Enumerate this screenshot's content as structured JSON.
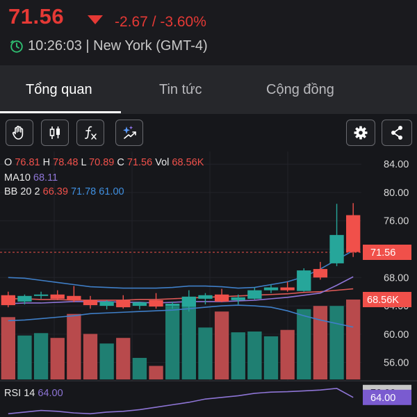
{
  "quote": {
    "price": "71.56",
    "change": "-2.67 / -3.60%",
    "time_zone": "10:26:03 | New York (GMT-4)",
    "colors": {
      "down": "#e53935",
      "up": "#26a69a",
      "clock": "#2fbf71"
    }
  },
  "tabs": [
    {
      "label": "Tổng quan",
      "active": true
    },
    {
      "label": "Tin tức",
      "active": false
    },
    {
      "label": "Cộng đồng",
      "active": false
    }
  ],
  "toolbar": {
    "left_icons": [
      "hand-icon",
      "candlestick-icon",
      "function-icon",
      "ai-sparkle-icon"
    ],
    "right_icons": [
      "gear-icon",
      "share-icon"
    ]
  },
  "legend": {
    "o_label": "O",
    "o_value": "76.81",
    "h_label": "H",
    "h_value": "78.48",
    "l_label": "L",
    "l_value": "70.89",
    "c_label": "C",
    "c_value": "71.56",
    "vol_label": "Vol",
    "vol_value": "68.56K",
    "ma_label": "MA10",
    "ma_value": "68.11",
    "bb_label": "BB 20 2",
    "bb_mid": "66.39",
    "bb_up": "71.78",
    "bb_low": "61.00",
    "rsi_label": "RSI 14",
    "rsi_value": "64.00"
  },
  "chart_data": {
    "type": "candlestick",
    "y_ticks": [
      "84.00",
      "80.00",
      "76.00",
      "72.00",
      "68.00",
      "64.00",
      "60.00",
      "56.00"
    ],
    "ylim": [
      54,
      85
    ],
    "current_price_tag": "71.56",
    "current_volume_tag": "68.56K",
    "rsi_ticks": [
      "70.00"
    ],
    "rsi_current_tag": "64.00",
    "candles": [
      {
        "o": 65.5,
        "h": 66.0,
        "l": 63.8,
        "c": 64.1,
        "vol": 0.78
      },
      {
        "o": 64.6,
        "h": 65.6,
        "l": 64.2,
        "c": 65.4,
        "vol": 0.55
      },
      {
        "o": 65.4,
        "h": 66.0,
        "l": 65.0,
        "c": 65.6,
        "vol": 0.58
      },
      {
        "o": 65.6,
        "h": 66.2,
        "l": 64.8,
        "c": 65.0,
        "vol": 0.52
      },
      {
        "o": 65.4,
        "h": 66.8,
        "l": 64.5,
        "c": 64.8,
        "vol": 0.82
      },
      {
        "o": 64.8,
        "h": 65.4,
        "l": 63.6,
        "c": 64.1,
        "vol": 0.57
      },
      {
        "o": 64.0,
        "h": 64.8,
        "l": 63.5,
        "c": 64.6,
        "vol": 0.45
      },
      {
        "o": 64.8,
        "h": 65.5,
        "l": 63.6,
        "c": 63.8,
        "vol": 0.52
      },
      {
        "o": 64.0,
        "h": 64.6,
        "l": 63.5,
        "c": 64.5,
        "vol": 0.27
      },
      {
        "o": 64.8,
        "h": 65.8,
        "l": 63.6,
        "c": 63.9,
        "vol": 0.17
      },
      {
        "o": 64.0,
        "h": 64.6,
        "l": 63.6,
        "c": 64.3,
        "vol": 0.92
      },
      {
        "o": 63.9,
        "h": 66.2,
        "l": 63.2,
        "c": 65.3,
        "vol": 0.94
      },
      {
        "o": 65.0,
        "h": 65.8,
        "l": 64.2,
        "c": 65.5,
        "vol": 0.65
      },
      {
        "o": 65.6,
        "h": 66.4,
        "l": 64.5,
        "c": 64.6,
        "vol": 0.85
      },
      {
        "o": 64.8,
        "h": 65.6,
        "l": 64.2,
        "c": 65.2,
        "vol": 0.59
      },
      {
        "o": 65.0,
        "h": 66.6,
        "l": 64.9,
        "c": 66.2,
        "vol": 0.6
      },
      {
        "o": 66.2,
        "h": 67.0,
        "l": 65.8,
        "c": 66.6,
        "vol": 0.54
      },
      {
        "o": 66.6,
        "h": 67.4,
        "l": 66.0,
        "c": 66.2,
        "vol": 0.62
      },
      {
        "o": 66.1,
        "h": 69.3,
        "l": 66.0,
        "c": 69.0,
        "vol": 0.88
      },
      {
        "o": 69.2,
        "h": 70.2,
        "l": 67.7,
        "c": 68.0,
        "vol": 0.92
      },
      {
        "o": 70.0,
        "h": 78.4,
        "l": 69.6,
        "c": 74.0,
        "vol": 0.92
      },
      {
        "o": 76.8,
        "h": 78.5,
        "l": 70.9,
        "c": 71.6,
        "vol": 1.0
      }
    ],
    "ma10": [
      64.3,
      64.4,
      64.4,
      64.5,
      64.6,
      64.6,
      64.6,
      64.5,
      64.5,
      64.4,
      64.5,
      64.6,
      64.6,
      64.6,
      64.7,
      64.8,
      65.0,
      65.2,
      65.5,
      65.8,
      66.9,
      68.1
    ],
    "bb_mid": [
      65.0,
      65.0,
      64.9,
      64.9,
      64.8,
      64.8,
      64.8,
      64.8,
      64.9,
      64.9,
      65.0,
      65.1,
      65.2,
      65.3,
      65.4,
      65.5,
      65.6,
      65.7,
      65.9,
      66.0,
      66.2,
      66.4
    ],
    "bb_up": [
      68.0,
      67.9,
      67.6,
      67.3,
      67.0,
      66.7,
      66.6,
      66.5,
      66.5,
      66.5,
      66.6,
      66.8,
      66.8,
      66.7,
      66.5,
      66.6,
      67.0,
      67.4,
      68.1,
      69.2,
      70.5,
      71.8
    ],
    "bb_low": [
      61.9,
      62.0,
      62.2,
      62.4,
      62.6,
      62.9,
      63.0,
      63.1,
      63.2,
      63.3,
      63.4,
      63.6,
      63.8,
      64.0,
      64.1,
      64.0,
      63.8,
      63.3,
      62.6,
      62.0,
      61.5,
      61.0
    ],
    "rsi": [
      44,
      46,
      48,
      47,
      45,
      44,
      46,
      47,
      49,
      52,
      55,
      58,
      62,
      64,
      66,
      69,
      70.5,
      71,
      72,
      73,
      75,
      64
    ]
  }
}
